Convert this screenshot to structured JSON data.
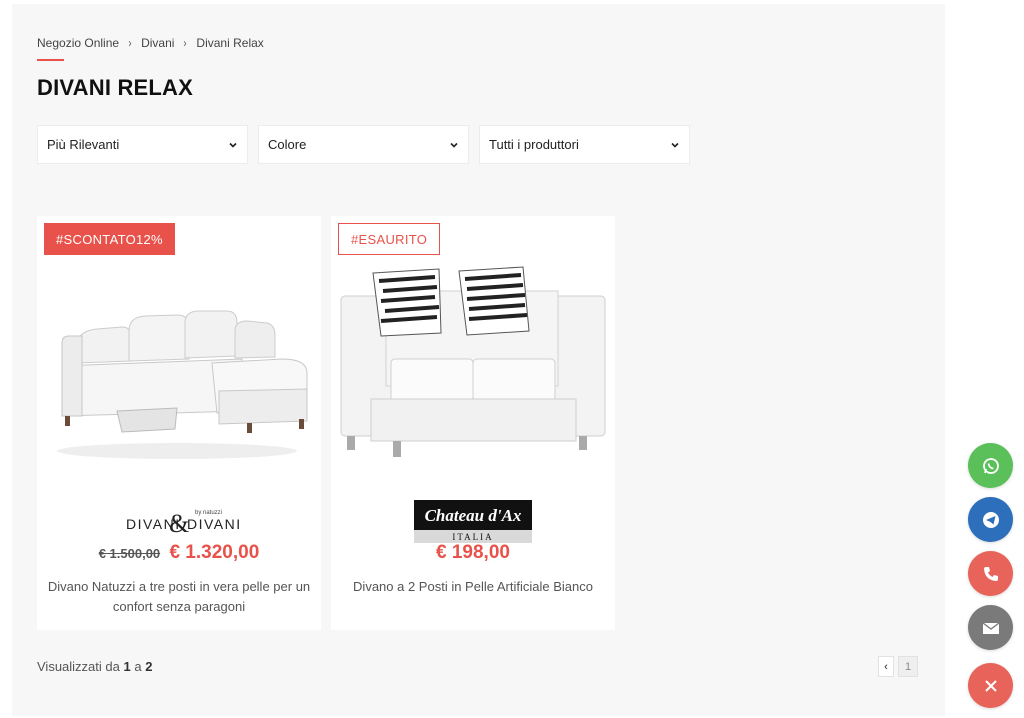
{
  "breadcrumb": {
    "items": [
      "Negozio Online",
      "Divani",
      "Divani Relax"
    ],
    "separator": "›"
  },
  "page_title": "DIVANI RELAX",
  "filters": [
    {
      "selected": "Più Rilevanti"
    },
    {
      "selected": "Colore"
    },
    {
      "selected": "Tutti i produttori"
    }
  ],
  "products": [
    {
      "badge": "#SCONTATO12%",
      "badge_style": "solid",
      "brand": "DIVANI & DIVANI by natuzzi",
      "brand_main_left": "DIVANI",
      "brand_main_right": "DIVANI",
      "brand_sub": "by natuzzi",
      "old_price": "€ 1.500,00",
      "price": "€ 1.320,00",
      "name": "Divano Natuzzi a tre posti in vera pelle per un confort senza paragoni"
    },
    {
      "badge": "#ESAURITO",
      "badge_style": "outline",
      "brand": "Chateau d'Ax ITALIA",
      "brand_main": "Chateau d'Ax",
      "brand_sub": "ITALIA",
      "old_price": "",
      "price": "€ 198,00",
      "name": "Divano a 2 Posti in Pelle Artificiale Bianco"
    }
  ],
  "results": {
    "prefix": "Visualizzati da",
    "from": "1",
    "middle": "a",
    "to": "2"
  },
  "pagination": {
    "prev": "‹",
    "current": "1"
  },
  "contact_buttons": [
    {
      "icon": "whatsapp-icon",
      "color": "#5bc05a"
    },
    {
      "icon": "telegram-icon",
      "color": "#2d6fba"
    },
    {
      "icon": "phone-icon",
      "color": "#e8645a"
    },
    {
      "icon": "mail-icon",
      "color": "#7a7a7a"
    },
    {
      "icon": "close-icon",
      "color": "#e8645a"
    }
  ],
  "colors": {
    "accent": "#e8524a",
    "background": "#f7f7f7"
  }
}
